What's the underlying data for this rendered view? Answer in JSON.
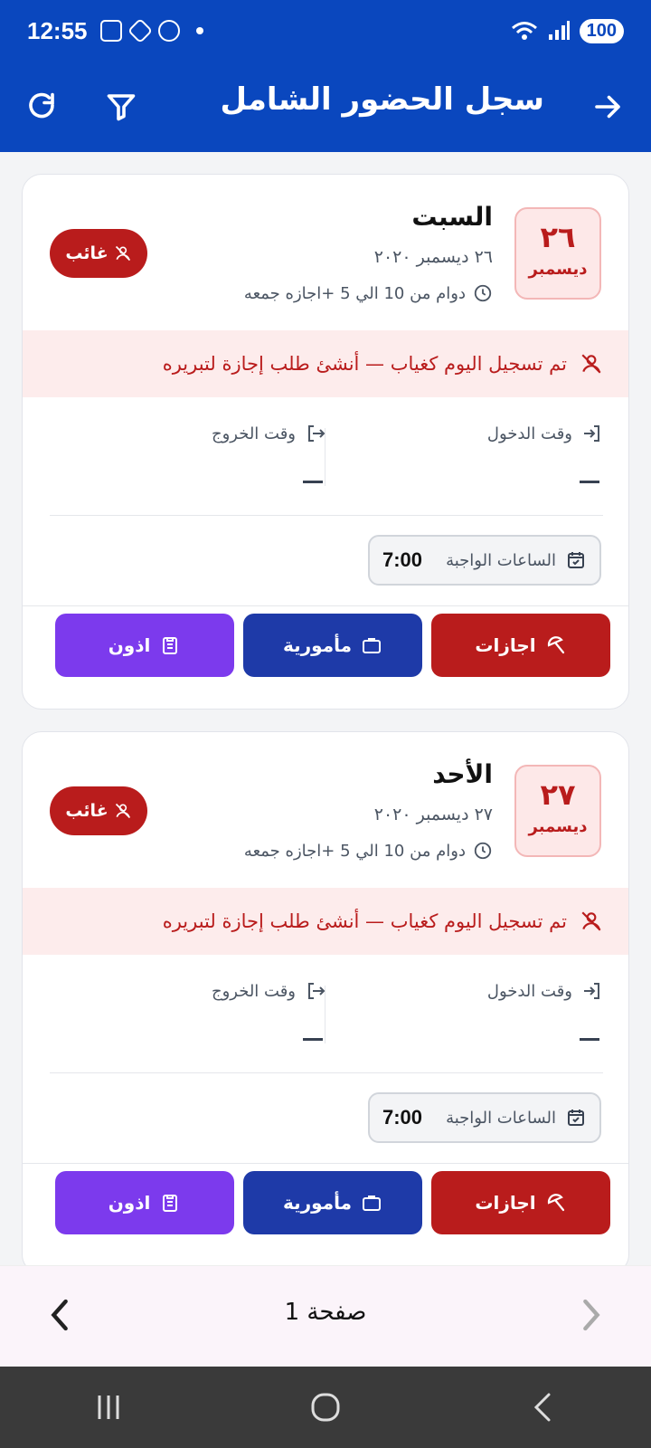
{
  "status_bar": {
    "time": "12:55",
    "battery": "100"
  },
  "app_bar": {
    "title": "سجل الحضور الشامل"
  },
  "cards": [
    {
      "day_number": "٢٦",
      "month": "ديسمبر",
      "day_name": "السبت",
      "full_date": "٢٦ ديسمبر ٢٠٢٠",
      "shift": "دوام من 10 الي 5 +اجازه جمعه",
      "badge": "غائب",
      "alert": "تم تسجيل اليوم كغياب — أنشئ طلب إجازة لتبريره",
      "check_in_label": "وقت الدخول",
      "check_out_label": "وقت الخروج",
      "check_in_value": "—",
      "check_out_value": "—",
      "required_hours_label": "الساعات الواجبة",
      "required_hours_value": "7:00",
      "buttons": {
        "vacations": "اجازات",
        "mission": "مأمورية",
        "permissions": "اذون"
      }
    },
    {
      "day_number": "٢٧",
      "month": "ديسمبر",
      "day_name": "الأحد",
      "full_date": "٢٧ ديسمبر ٢٠٢٠",
      "shift": "دوام من 10 الي 5 +اجازه جمعه",
      "badge": "غائب",
      "alert": "تم تسجيل اليوم كغياب — أنشئ طلب إجازة لتبريره",
      "check_in_label": "وقت الدخول",
      "check_out_label": "وقت الخروج",
      "check_in_value": "—",
      "check_out_value": "—",
      "required_hours_label": "الساعات الواجبة",
      "required_hours_value": "7:00",
      "buttons": {
        "vacations": "اجازات",
        "mission": "مأمورية",
        "permissions": "اذون"
      }
    }
  ],
  "pager": {
    "label": "صفحة 1"
  },
  "colors": {
    "primary": "#0a47be",
    "absent": "#b91c1c",
    "mission": "#1e3aa8",
    "permission": "#7c3aed"
  }
}
